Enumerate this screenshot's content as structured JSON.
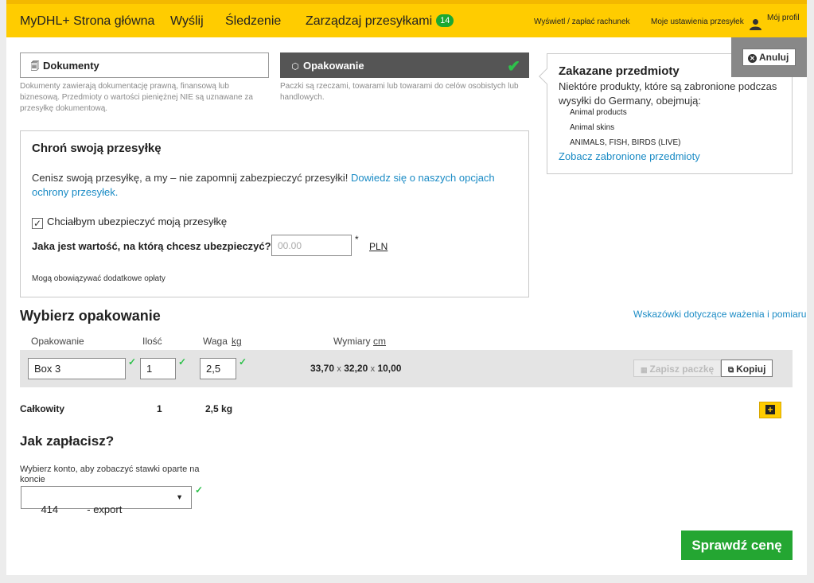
{
  "topbar": {
    "home": "MyDHL+ Strona główna",
    "send": "Wyślij",
    "track": "Śledzenie",
    "manage": "Zarządzaj przesyłkami",
    "manage_badge": "14",
    "billing": "Wyświetl / zapłać rachunek",
    "settings": "Moje ustawienia przesyłek",
    "profile": "Mój profil"
  },
  "tabs": {
    "documents": {
      "label": "Dokumenty",
      "desc": "Dokumenty zawierają dokumentację prawną, finansową lub biznesową. Przedmioty o wartości pieniężnej NIE są uznawane za przesyłkę dokumentową."
    },
    "package": {
      "label": "Opakowanie",
      "desc": "Paczki są rzeczami, towarami lub towarami do celów osobistych lub handlowych."
    }
  },
  "forbidden": {
    "cancel": "Anuluj",
    "title": "Zakazane przedmioty",
    "text": "Niektóre produkty, które są zabronione podczas wysyłki do Germany, obejmują:",
    "items": [
      "Animal products",
      "Animal skins",
      "ANIMALS, FISH, BIRDS (LIVE)"
    ],
    "link": "Zobacz zabronione przedmioty"
  },
  "protect": {
    "title": "Chroń swoją przesyłkę",
    "text": "Cenisz swoją przesyłkę, a my – nie zapomnij zabezpieczyć przesyłki!",
    "link_line1": "Dowiedz się o naszych opcjach",
    "link_line2": "ochrony przesyłek.",
    "checkbox_label": "Chciałbym ubezpieczyć moją przesyłkę",
    "value_question": "Jaka jest wartość, na którą chcesz ubezpieczyć?",
    "value_placeholder": "00.00",
    "required_mark": "*",
    "currency": "PLN",
    "fees_note": "Mogą obowiązywać dodatkowe opłaty"
  },
  "packaging": {
    "title": "Wybierz opakowanie",
    "tips_link": "Wskazówki dotyczące ważenia i pomiaru",
    "col_packaging": "Opakowanie",
    "col_quantity": "Ilość",
    "col_weight": "Waga",
    "weight_unit": "kg",
    "col_dimensions": "Wymiary",
    "dim_unit": "cm",
    "row": {
      "package": "Box 3",
      "quantity": "1",
      "weight": "2,5",
      "dim_l": "33,70",
      "dim_w": "32,20",
      "dim_h": "10,00",
      "times": "x"
    },
    "save_button": "Zapisz paczkę",
    "copy_button": "Kopiuj",
    "total_label": "Całkowity",
    "total_quantity": "1",
    "total_weight": "2,5 kg"
  },
  "payment": {
    "title": "Jak zapłacisz?",
    "account_label": "Wybierz konto, aby zobaczyć stawki oparte na koncie",
    "account_value": "414          - export"
  },
  "check_price": "Sprawdź cenę"
}
